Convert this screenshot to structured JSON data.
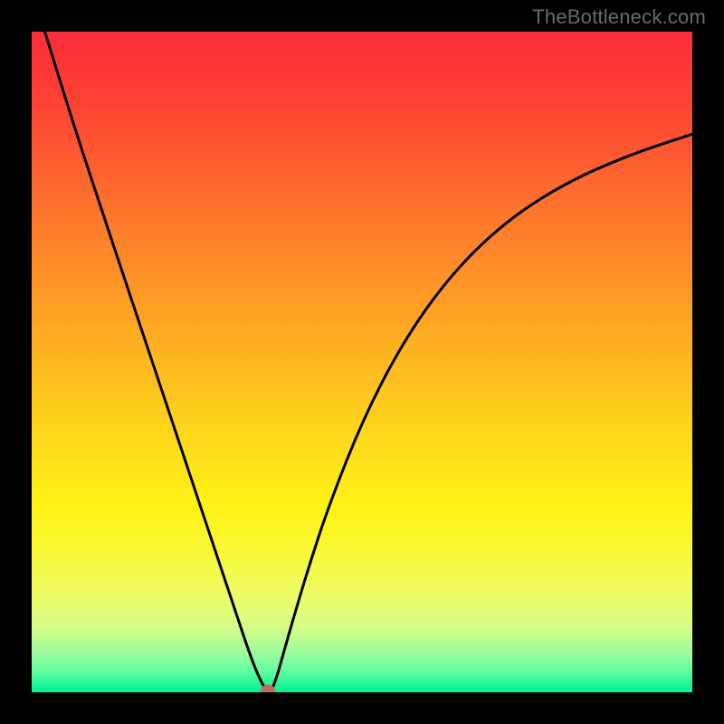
{
  "watermark": "TheBottleneck.com",
  "chart_data": {
    "type": "line",
    "title": "",
    "xlabel": "",
    "ylabel": "",
    "xlim": [
      0.0,
      1.0
    ],
    "ylim": [
      0.0,
      1.0
    ],
    "background_gradient": {
      "stops": [
        {
          "offset": 0.0,
          "color": "#fc2c3a"
        },
        {
          "offset": 0.1,
          "color": "#fd4135"
        },
        {
          "offset": 0.2,
          "color": "#fd5f30"
        },
        {
          "offset": 0.3,
          "color": "#fe7d2b"
        },
        {
          "offset": 0.4,
          "color": "#fe9a26"
        },
        {
          "offset": 0.5,
          "color": "#feb821"
        },
        {
          "offset": 0.6,
          "color": "#fed51c"
        },
        {
          "offset": 0.72,
          "color": "#fff317"
        },
        {
          "offset": 0.78,
          "color": "#f9f831"
        },
        {
          "offset": 0.85,
          "color": "#f0fc65"
        },
        {
          "offset": 0.9,
          "color": "#d7fd87"
        },
        {
          "offset": 0.94,
          "color": "#9efd9c"
        },
        {
          "offset": 0.97,
          "color": "#5cfea1"
        },
        {
          "offset": 1.0,
          "color": "#01ed94"
        }
      ]
    },
    "series": [
      {
        "name": "curve",
        "x": [
          0.02,
          0.06,
          0.1,
          0.14,
          0.18,
          0.22,
          0.26,
          0.29,
          0.31,
          0.33,
          0.345,
          0.357,
          0.362,
          0.37,
          0.38,
          0.395,
          0.42,
          0.45,
          0.5,
          0.56,
          0.63,
          0.71,
          0.8,
          0.9,
          1.0
        ],
        "y": [
          1.0,
          0.87,
          0.748,
          0.628,
          0.508,
          0.388,
          0.268,
          0.178,
          0.118,
          0.058,
          0.02,
          0.0,
          0.0,
          0.02,
          0.055,
          0.108,
          0.192,
          0.283,
          0.41,
          0.527,
          0.627,
          0.707,
          0.767,
          0.812,
          0.845
        ]
      }
    ],
    "marker": {
      "x": 0.357,
      "y": 0.0,
      "color": "#c9695f"
    }
  }
}
